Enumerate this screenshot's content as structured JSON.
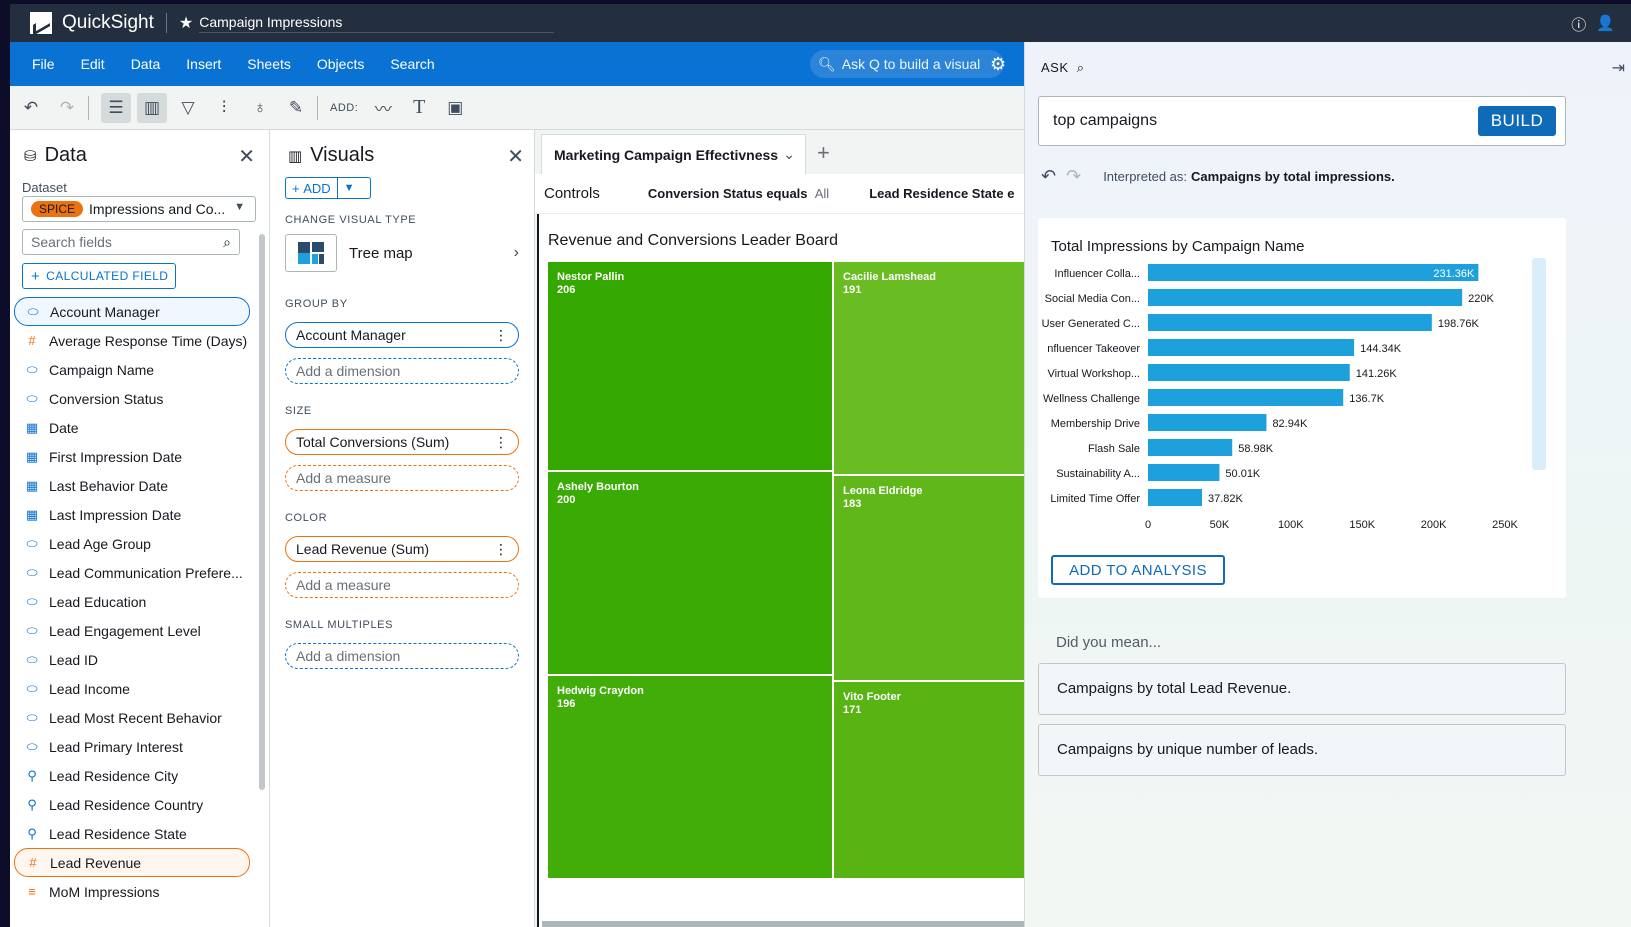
{
  "app": {
    "name": "QuickSight",
    "doc_title": "Campaign Impressions"
  },
  "menu": [
    "File",
    "Edit",
    "Data",
    "Insert",
    "Sheets",
    "Objects",
    "Search"
  ],
  "ask_q": "Ask Q to build a visual",
  "toolbar": {
    "add_label": "ADD:"
  },
  "data_panel": {
    "title": "Data",
    "dataset_label": "Dataset",
    "dataset_badge": "SPICE",
    "dataset_name": "Impressions and Co...",
    "search_placeholder": "Search fields",
    "calc_field": "CALCULATED FIELD",
    "fields": [
      {
        "label": "Account Manager",
        "icon": "dimension-icon"
      },
      {
        "label": "Average Response Time (Days)",
        "icon": "measure-icon"
      },
      {
        "label": "Campaign Name",
        "icon": "dimension-icon"
      },
      {
        "label": "Conversion Status",
        "icon": "dimension-icon"
      },
      {
        "label": "Date",
        "icon": "date-icon"
      },
      {
        "label": "First Impression Date",
        "icon": "date-icon"
      },
      {
        "label": "Last Behavior Date",
        "icon": "date-icon"
      },
      {
        "label": "Last Impression Date",
        "icon": "date-icon"
      },
      {
        "label": "Lead Age Group",
        "icon": "dimension-icon"
      },
      {
        "label": "Lead Communication Prefere...",
        "icon": "dimension-icon"
      },
      {
        "label": "Lead Education",
        "icon": "dimension-icon"
      },
      {
        "label": "Lead Engagement Level",
        "icon": "dimension-icon"
      },
      {
        "label": "Lead ID",
        "icon": "dimension-icon"
      },
      {
        "label": "Lead Income",
        "icon": "dimension-icon"
      },
      {
        "label": "Lead Most Recent Behavior",
        "icon": "dimension-icon"
      },
      {
        "label": "Lead Primary Interest",
        "icon": "dimension-icon"
      },
      {
        "label": "Lead Residence City",
        "icon": "geo-icon"
      },
      {
        "label": "Lead Residence Country",
        "icon": "geo-icon"
      },
      {
        "label": "Lead Residence State",
        "icon": "geo-icon"
      },
      {
        "label": "Lead Revenue",
        "icon": "measure-icon"
      },
      {
        "label": "MoM Impressions",
        "icon": "calc-icon"
      }
    ]
  },
  "visuals_panel": {
    "title": "Visuals",
    "add": "ADD",
    "change_type_label": "CHANGE VISUAL TYPE",
    "visual_type": "Tree map",
    "group_by_label": "GROUP BY",
    "group_by_value": "Account Manager",
    "add_dimension": "Add a dimension",
    "size_label": "SIZE",
    "size_value": "Total Conversions (Sum)",
    "add_measure": "Add a measure",
    "color_label": "COLOR",
    "color_value": "Lead Revenue (Sum)",
    "small_multiples_label": "SMALL MULTIPLES"
  },
  "canvas": {
    "sheet_tab": "Marketing Campaign Effectivness",
    "controls_label": "Controls",
    "control1_name": "Conversion Status equals",
    "control1_value": "All",
    "control2_name": "Lead Residence State e",
    "visual_title": "Revenue and Conversions Leader Board",
    "tiles": [
      {
        "name": "Nestor Pallin",
        "value": "206",
        "color": "#34a800"
      },
      {
        "name": "Cacilie Lamshead",
        "value": "191",
        "color": "#69bd22"
      },
      {
        "name": "Ashely Bourton",
        "value": "200",
        "color": "#3aaa04"
      },
      {
        "name": "Leona Eldridge",
        "value": "183",
        "color": "#60b71a"
      },
      {
        "name": "Hedwig Craydon",
        "value": "196",
        "color": "#42ad08"
      },
      {
        "name": "Vito Footer",
        "value": "171",
        "color": "#58b413"
      }
    ]
  },
  "q_panel": {
    "ask_label": "ASK",
    "query": "top campaigns",
    "build": "BUILD",
    "interpreted_prefix": "Interpreted as:",
    "interpreted_value": "Campaigns by total impressions.",
    "add_to_analysis": "ADD TO ANALYSIS",
    "did_you_mean": "Did you mean...",
    "suggestions": [
      "Campaigns by total Lead Revenue.",
      "Campaigns by unique number of leads."
    ],
    "bar_color": "#1ea0dc"
  },
  "chart_data": {
    "type": "bar",
    "orientation": "horizontal",
    "title": "Total Impressions by Campaign Name",
    "categories": [
      "Influencer Colla...",
      "Social Media Con...",
      "User Generated C...",
      "nfluencer Takeover",
      "Virtual Workshop...",
      "Wellness Challenge",
      "Membership Drive",
      "Flash Sale",
      "Sustainability A...",
      "Limited Time Offer"
    ],
    "values": [
      231360,
      220000,
      198760,
      144340,
      141260,
      136700,
      82940,
      58980,
      50010,
      37820
    ],
    "value_labels": [
      "231.36K",
      "220K",
      "198.76K",
      "144.34K",
      "141.26K",
      "136.7K",
      "82.94K",
      "58.98K",
      "50.01K",
      "37.82K"
    ],
    "xlim": [
      0,
      250000
    ],
    "x_ticks": [
      0,
      50000,
      100000,
      150000,
      200000,
      250000
    ],
    "x_tick_labels": [
      "0",
      "50K",
      "100K",
      "150K",
      "200K",
      "250K"
    ],
    "grid": false
  }
}
